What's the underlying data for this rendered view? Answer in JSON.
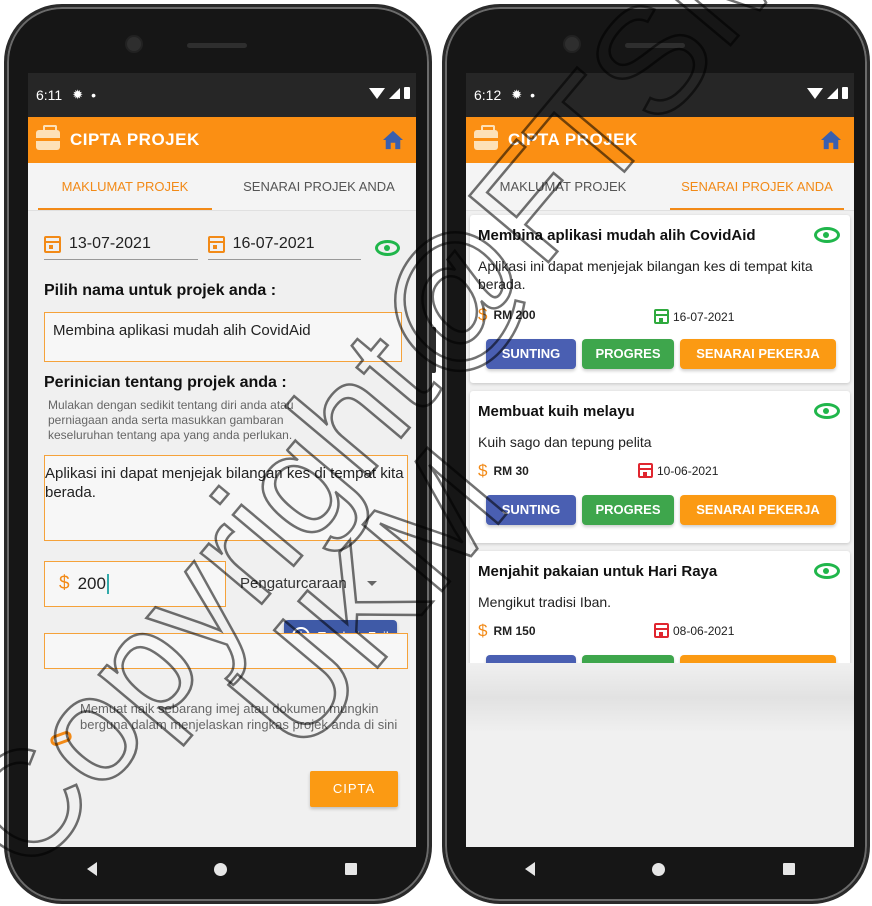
{
  "left": {
    "status": {
      "time": "6:11"
    },
    "appbar": {
      "title": "CIPTA PROJEK"
    },
    "tabs": [
      {
        "label": "MAKLUMAT PROJEK",
        "active": true
      },
      {
        "label": "SENARAI PROJEK ANDA",
        "active": false
      }
    ],
    "form": {
      "start_date": "13-07-2021",
      "end_date": "16-07-2021",
      "name_heading": "Pilih nama untuk projek anda :",
      "name_value": "Membina aplikasi mudah alih CovidAid",
      "detail_heading": "Perinician tentang projek anda :",
      "detail_helper": "Mulakan dengan sedikit tentang diri anda atau perniagaan anda serta masukkan gambaran keseluruhan tentang apa yang anda perlukan.",
      "detail_value": "Aplikasi ini dapat menjejak bilangan kes di tempat kita berada.",
      "currency_symbol": "$",
      "budget_value": "200",
      "category_value": "Pengaturcaraan",
      "add_file_label": "Tambah Fail",
      "upload_hint": "Memuat naik sebarang imej atau dokumen mungkin berguna dalam menjelaskan ringkas projek anda di sini",
      "submit_label": "CIPTA"
    }
  },
  "right": {
    "status": {
      "time": "6:12"
    },
    "appbar": {
      "title": "CIPTA PROJEK"
    },
    "tabs": [
      {
        "label": "MAKLUMAT PROJEK",
        "active": false
      },
      {
        "label": "SENARAI PROJEK ANDA",
        "active": true
      }
    ],
    "buttons": {
      "edit": "SUNTING",
      "progress": "PROGRES",
      "workers": "SENARAI PEKERJA"
    },
    "projects": [
      {
        "title": "Membina aplikasi mudah alih CovidAid",
        "description": "Aplikasi ini dapat menjejak  bilangan kes di tempat kita berada.",
        "price": "RM 200",
        "date": "16-07-2021",
        "date_color": "#2faa3e"
      },
      {
        "title": "Membuat kuih melayu",
        "description": "Kuih sago dan tepung pelita",
        "price": "RM 30",
        "date": "10-06-2021",
        "date_color": "#e0262f"
      },
      {
        "title": "Menjahit pakaian untuk Hari Raya",
        "description": "Mengikut tradisi Iban.",
        "price": "RM 150",
        "date": "08-06-2021",
        "date_color": "#e0262f"
      }
    ]
  },
  "watermark": {
    "text_1": "Copyright@FTSM",
    "text_2": "UKM"
  },
  "colors": {
    "primary": "#fb8f13",
    "eye": "#20b64b",
    "edit_button": "#4a5fb2",
    "progress_button": "#3ea64c",
    "workers_button": "#fb9a13"
  }
}
